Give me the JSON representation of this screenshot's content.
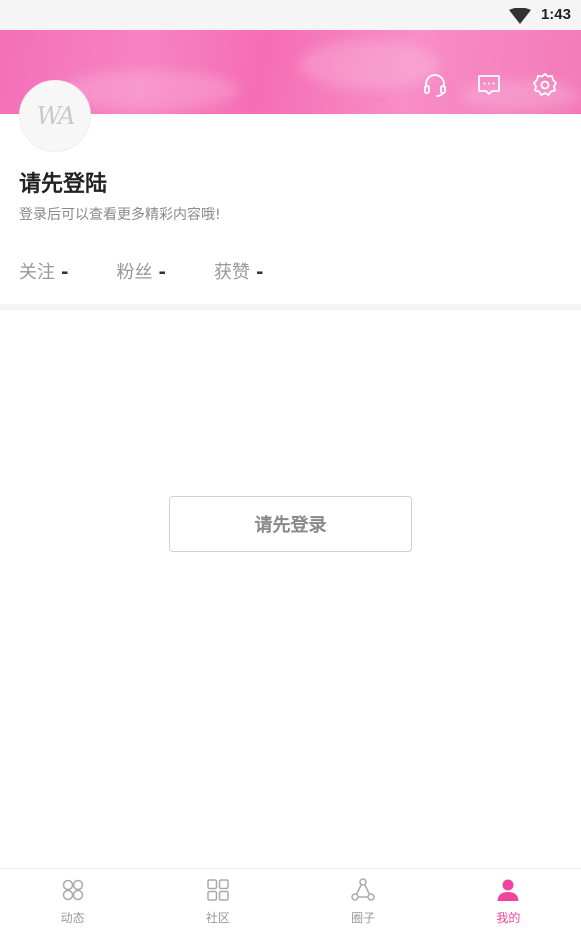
{
  "status_bar": {
    "time": "1:43",
    "wifi_icon": "wifi-icon"
  },
  "header": {
    "icons": [
      "headset-icon",
      "message-icon",
      "gear-icon"
    ],
    "accent_color": "#f56db5"
  },
  "profile": {
    "avatar_text": "WA",
    "title": "请先登陆",
    "subtitle": "登录后可以查看更多精彩内容哦!",
    "stats": [
      {
        "label": "关注",
        "value": "-"
      },
      {
        "label": "粉丝",
        "value": "-"
      },
      {
        "label": "获赞",
        "value": "-"
      }
    ]
  },
  "main": {
    "login_button": "请先登录"
  },
  "tabbar": {
    "active_color": "#f0449f",
    "items": [
      {
        "label": "动态",
        "icon": "clover-grid-icon"
      },
      {
        "label": "社区",
        "icon": "grid-icon"
      },
      {
        "label": "圈子",
        "icon": "circle-nodes-icon"
      },
      {
        "label": "我的",
        "icon": "person-icon"
      }
    ]
  }
}
